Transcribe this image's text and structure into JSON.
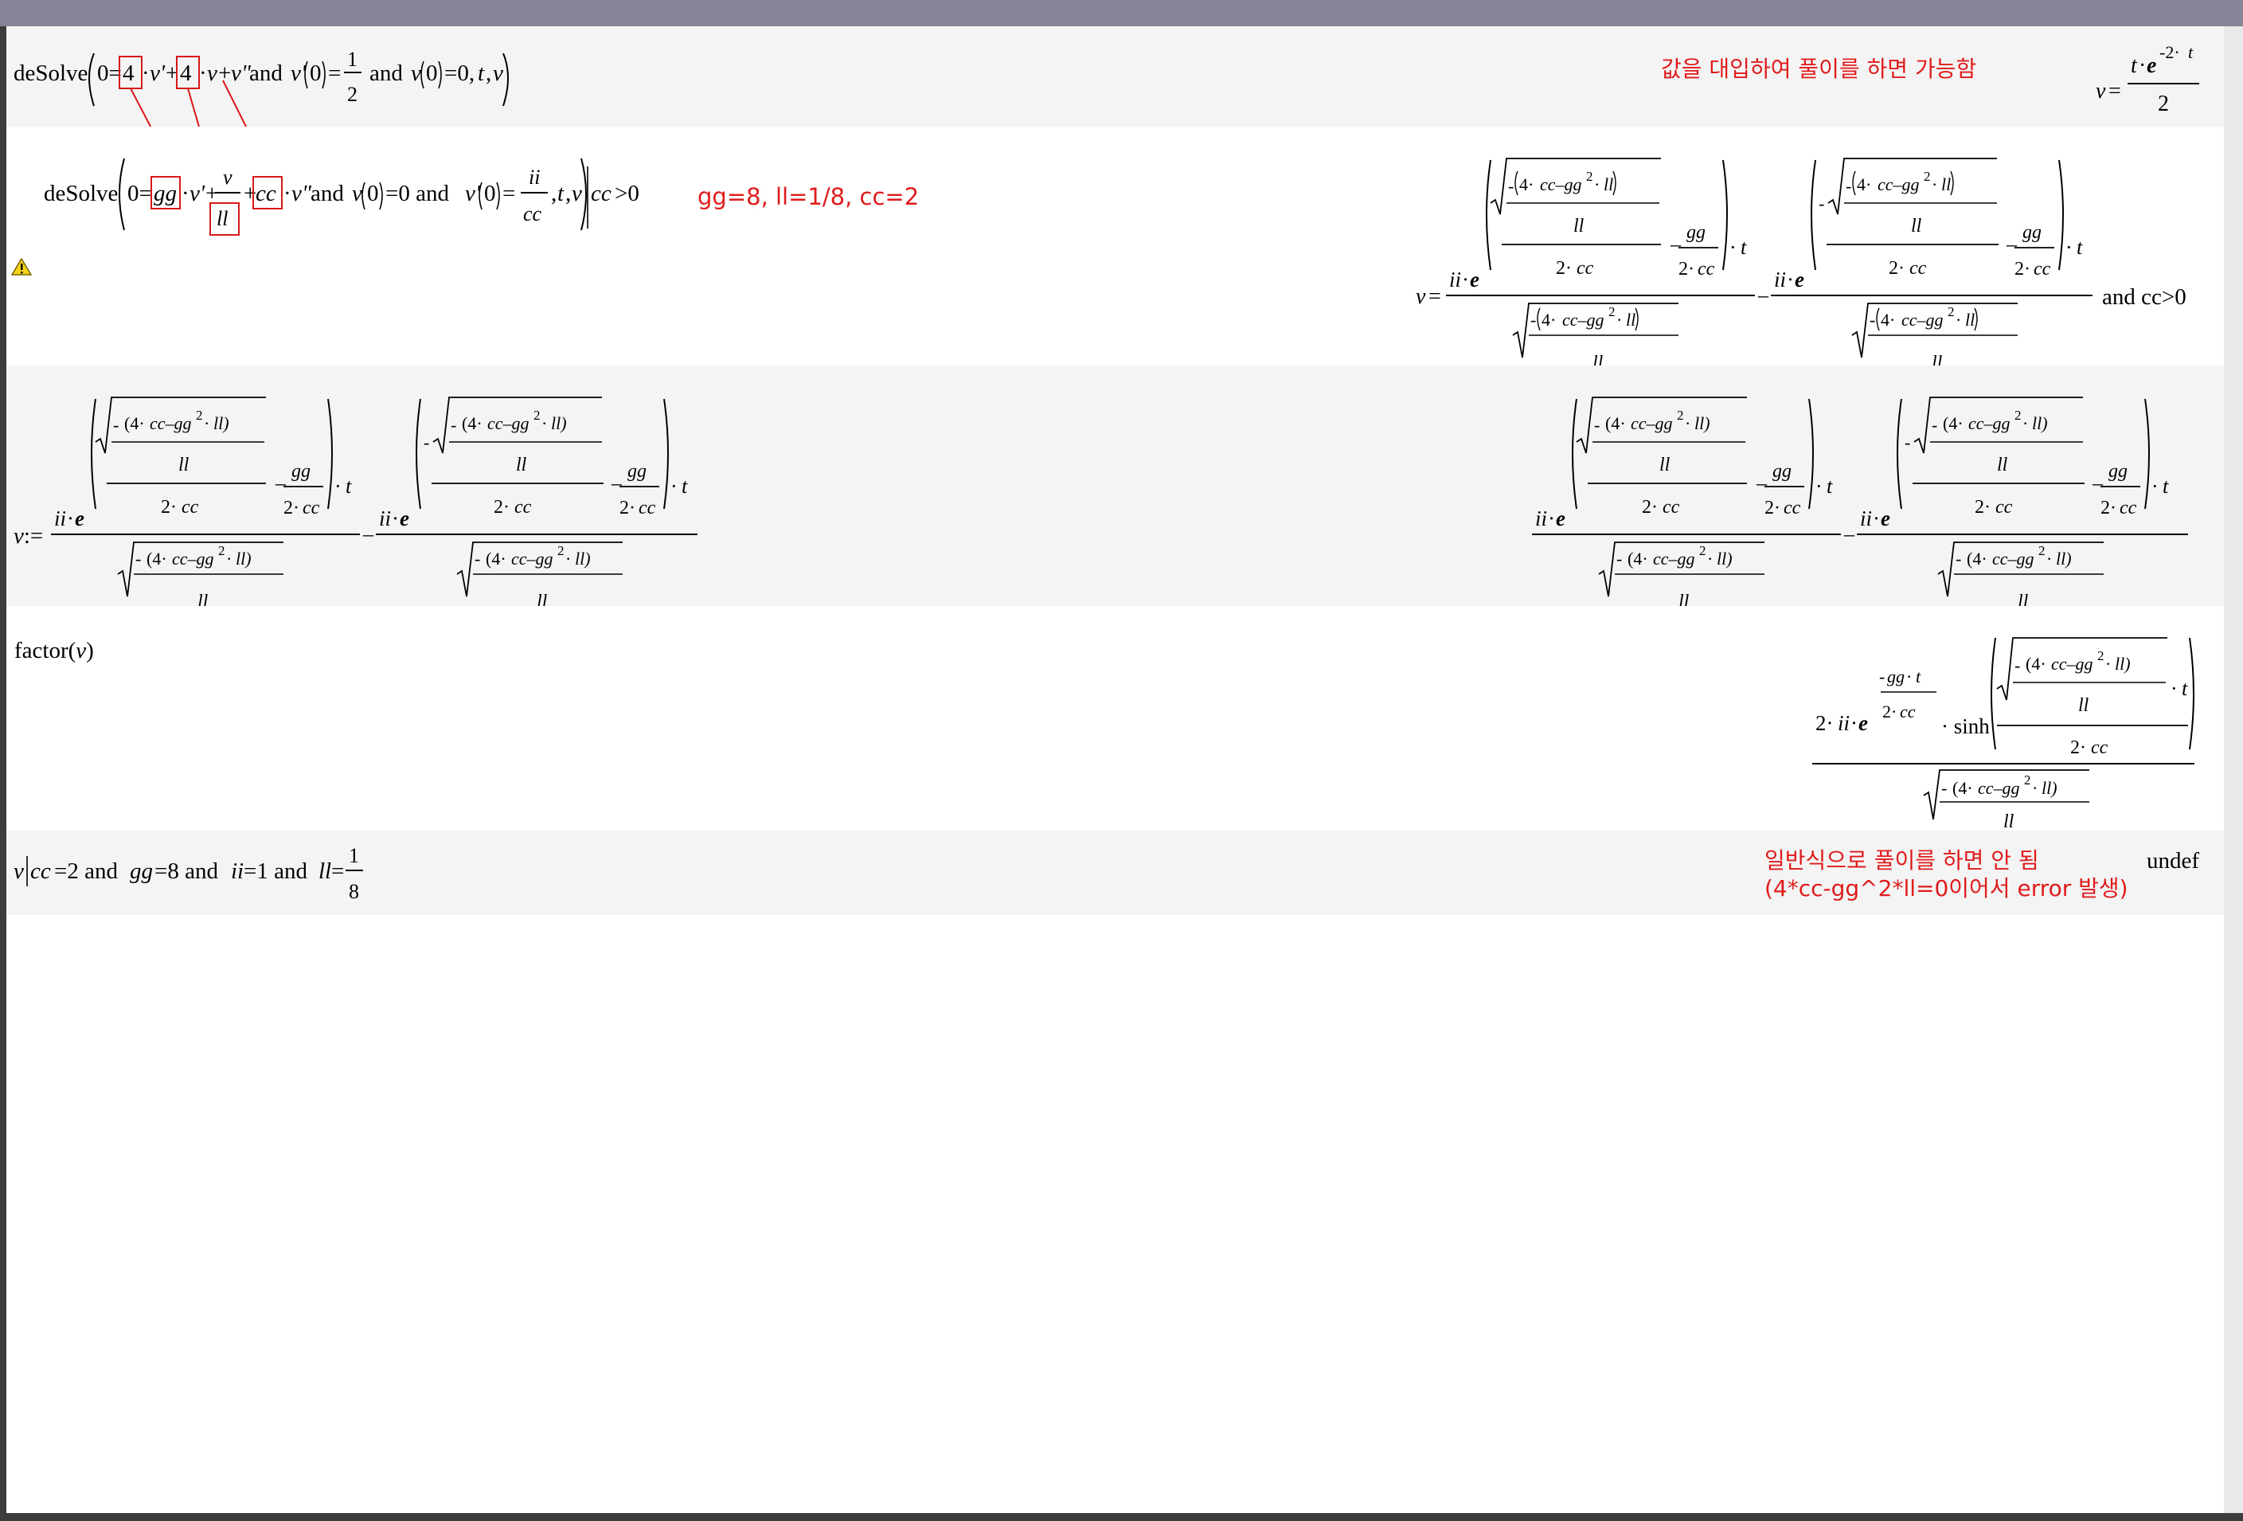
{
  "window": {
    "titlebar_color": "#868497"
  },
  "rows": {
    "r1": {
      "input": "deSolve(0=4·v'+4·v+v\" and v'(0)=1/2 and v(0)=0,t,v)",
      "note": "값을 대입하여 풀이를 하면 가능함",
      "result": "v=t·e^(-2·t)/2"
    },
    "r2": {
      "input": "deSolve(0=gg·v'+v/ll+cc·v\" and v(0)=0 and v'(0)=ii/cc,t,v)|cc>0",
      "values_note": "gg=8, ll=1/8, cc=2",
      "result_suffix": "and cc>0",
      "warning_icon": "warning-triangle-icon"
    },
    "r3": {
      "input": "v:="
    },
    "r4": {
      "input": "factor(v)"
    },
    "r5": {
      "input": "v|cc=2 and gg=8 and ii=1 and ll=1/8",
      "note_line1": "일반식으로 풀이를 하면 안 됨",
      "note_line2": "(4*cc-gg^2*ll=0이어서 error 발생)",
      "result": "undef"
    }
  },
  "colors": {
    "annotation": "#e01b1b",
    "row_shade": "#f4f4f4",
    "background": "#ffffff"
  }
}
